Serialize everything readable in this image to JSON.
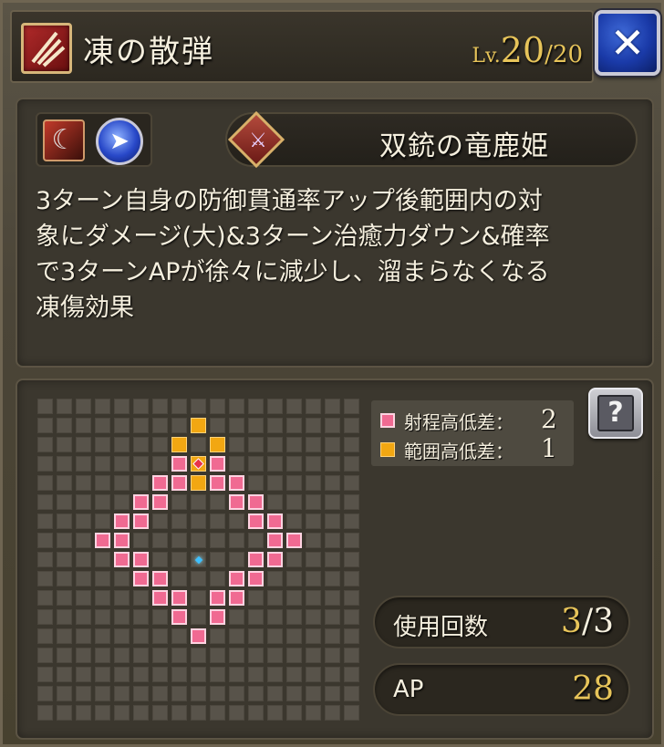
{
  "header": {
    "skill_type_icon": "bow-skill-icon",
    "title": "凍の散弾",
    "level_prefix": "Lv.",
    "level_current": "20",
    "level_max": "/20",
    "close_label": "✕"
  },
  "info": {
    "attribute_icons": [
      "slash-ice-icon",
      "blue-arrow-orb-icon"
    ],
    "unit_icon": "crossbow-class-icon",
    "unit_name": "双銃の竜鹿姫",
    "description_lines": [
      "3ターン自身の防御貫通率アップ後範囲内の対",
      "象にダメージ(大)&3ターン治癒力ダウン&確率",
      "で3ターンAPが徐々に減少し、溜まらなくなる",
      "凍傷効果"
    ]
  },
  "range": {
    "grid_size": 17,
    "range_cells": [
      [
        8,
        12
      ],
      [
        7,
        11
      ],
      [
        9,
        11
      ],
      [
        6,
        10
      ],
      [
        7,
        10
      ],
      [
        9,
        10
      ],
      [
        10,
        10
      ],
      [
        5,
        9
      ],
      [
        6,
        9
      ],
      [
        10,
        9
      ],
      [
        11,
        9
      ],
      [
        4,
        8
      ],
      [
        5,
        8
      ],
      [
        11,
        8
      ],
      [
        12,
        8
      ],
      [
        3,
        7
      ],
      [
        4,
        7
      ],
      [
        12,
        7
      ],
      [
        13,
        7
      ],
      [
        4,
        6
      ],
      [
        5,
        6
      ],
      [
        11,
        6
      ],
      [
        12,
        6
      ],
      [
        5,
        5
      ],
      [
        6,
        5
      ],
      [
        10,
        5
      ],
      [
        11,
        5
      ],
      [
        6,
        4
      ],
      [
        7,
        4
      ],
      [
        9,
        4
      ],
      [
        10,
        4
      ],
      [
        7,
        3
      ],
      [
        9,
        3
      ],
      [
        7,
        2
      ],
      [
        9,
        2
      ]
    ],
    "aoe_cells": [
      [
        8,
        1
      ],
      [
        7,
        2
      ],
      [
        9,
        2
      ],
      [
        8,
        4
      ],
      [
        8,
        3
      ]
    ],
    "target_cell": [
      8,
      3
    ],
    "center_cell": [
      8,
      8
    ],
    "legend": {
      "range_label": "射程高低差：",
      "range_value": "2",
      "aoe_label": "範囲高低差：",
      "aoe_value": "1"
    },
    "help_label": "?",
    "uses_label": "使用回数",
    "uses_current": "3",
    "uses_max": "/3",
    "ap_label": "AP",
    "ap_value": "28"
  },
  "colors": {
    "range": "#f06a92",
    "aoe": "#f2a712",
    "level": "#e7c45a",
    "close_button": "#1a3aa8"
  }
}
